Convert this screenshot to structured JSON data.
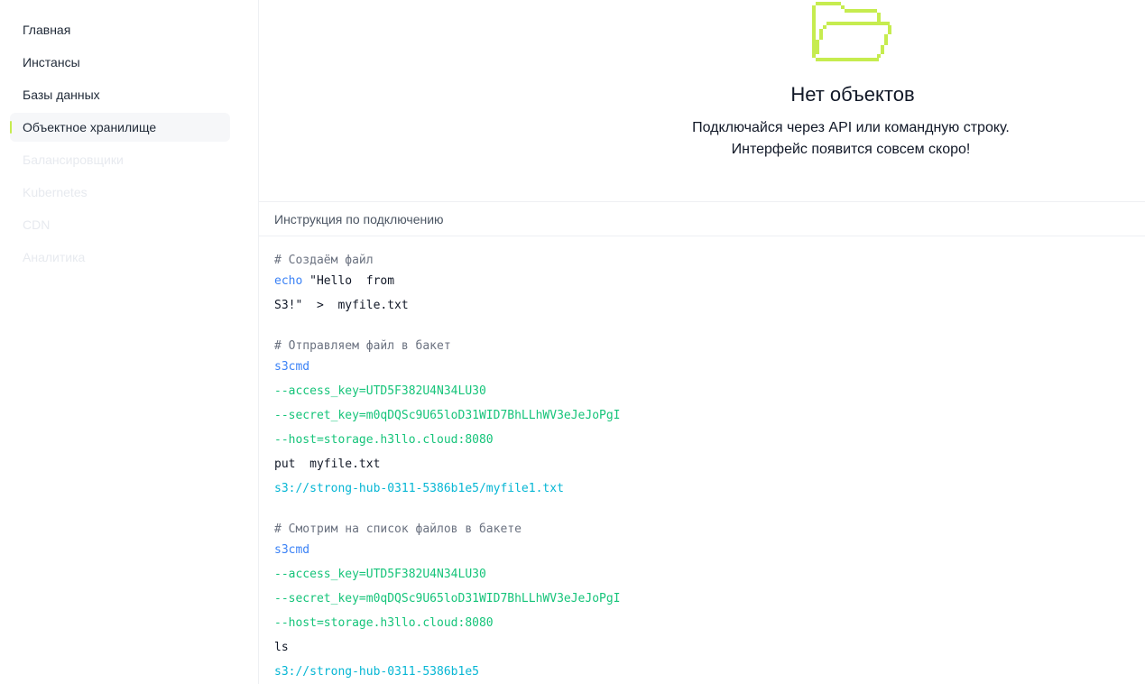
{
  "sidebar": {
    "items": [
      {
        "label": "Главная"
      },
      {
        "label": "Инстансы"
      },
      {
        "label": "Базы данных"
      },
      {
        "label": "Объектное хранилище"
      },
      {
        "label": "Балансировщики"
      },
      {
        "label": "Kubernetes"
      },
      {
        "label": "CDN"
      },
      {
        "label": "Аналитика"
      }
    ],
    "active_index": 3
  },
  "empty_state": {
    "icon": "folder-icon",
    "title": "Нет объектов",
    "subtitle_line1": "Подключайся через API или командную строку.",
    "subtitle_line2": "Интерфейс появится совсем скоро!"
  },
  "instructions": {
    "header": "Инструкция по подключению",
    "block1": {
      "comment": "# Создаём файл",
      "cmd": "echo",
      "arg1": " \"Hello  from",
      "line2": "S3!\"  >  myfile.txt"
    },
    "block2": {
      "comment": "# Отправляем файл в бакет",
      "cmd": "s3cmd",
      "access_key": "--access_key=UTD5F382U4N34LU30",
      "secret_key": "--secret_key=m0qDQSc9U65loD31WID7BhLLhWV3eJeJoPgI",
      "host": "--host=storage.h3llo.cloud:8080",
      "action": "put  myfile.txt",
      "target": "s3://strong-hub-0311-5386b1e5/myfile1.txt"
    },
    "block3": {
      "comment": "# Смотрим на список файлов в бакете",
      "cmd": "s3cmd",
      "access_key": "--access_key=UTD5F382U4N34LU30",
      "secret_key": "--secret_key=m0qDQSc9U65loD31WID7BhLLhWV3eJeJoPgI",
      "host": "--host=storage.h3llo.cloud:8080",
      "action": "ls",
      "target": "s3://strong-hub-0311-5386b1e5"
    }
  },
  "colors": {
    "accent": "#c6ec4f",
    "command": "#3b82f6",
    "flag": "#16c47a",
    "path": "#06b6d4",
    "comment": "#6b7280"
  }
}
